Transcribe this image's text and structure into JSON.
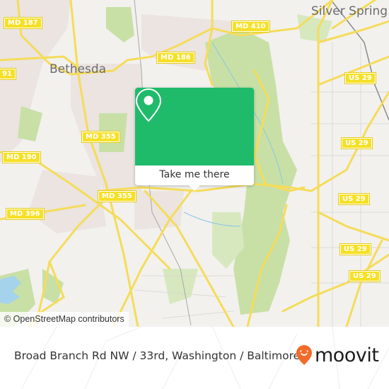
{
  "map": {
    "city_labels": [
      {
        "id": "bethesda",
        "text": "Bethesda"
      },
      {
        "id": "silver-spring",
        "text": "Silver Spring"
      }
    ],
    "route_shields": [
      {
        "id": "md-187",
        "text": "MD 187"
      },
      {
        "id": "md-410",
        "text": "MD 410"
      },
      {
        "id": "md-186",
        "text": "MD 186"
      },
      {
        "id": "md-91",
        "text": "91"
      },
      {
        "id": "md-355-upper",
        "text": "MD 355"
      },
      {
        "id": "md-190",
        "text": "MD 190"
      },
      {
        "id": "md-355-lower",
        "text": "MD 355"
      },
      {
        "id": "md-396",
        "text": "MD 396"
      },
      {
        "id": "us-29-a",
        "text": "US 29"
      },
      {
        "id": "us-29-b",
        "text": "US 29"
      },
      {
        "id": "us-29-c",
        "text": "US 29"
      },
      {
        "id": "us-29-d",
        "text": "US 29"
      },
      {
        "id": "us-29-e",
        "text": "US 29"
      }
    ],
    "attribution": "© OpenStreetMap contributors",
    "colors": {
      "land": "#f2f1ee",
      "park": "#c8e0a6",
      "water": "#a5d3ec",
      "road": "#f5dc5a",
      "urban": "#ebe4e1"
    }
  },
  "popup": {
    "icon": "map-pin-icon",
    "button_label": "Take me there",
    "accent_color": "#20ba6b"
  },
  "footer": {
    "address": "Broad Branch Rd NW / 33rd, Washington / Baltimore",
    "brand": "moovit",
    "brand_color": "#f26b2a"
  }
}
